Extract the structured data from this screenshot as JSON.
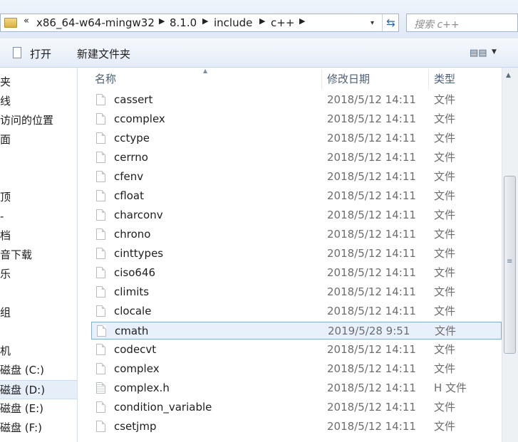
{
  "address": {
    "overflow": "«",
    "crumbs": [
      "x86_64-w64-mingw32",
      "8.1.0",
      "include",
      "c++"
    ],
    "dropdown_arrow": "▾",
    "refresh_icon": "refresh-icon",
    "search_placeholder": "搜索 c++"
  },
  "toolbar": {
    "open_label": "打开",
    "new_folder_label": "新建文件夹"
  },
  "columns": {
    "name": "名称",
    "date": "修改日期",
    "type": "类型"
  },
  "nav": {
    "items": [
      "夹",
      "线",
      "访问的位置",
      "面",
      "",
      "",
      "顶",
      "-",
      "档",
      "音下载",
      "乐",
      "",
      "组",
      "",
      "机",
      "磁盘 (C:)",
      "磁盘 (D:)",
      "磁盘 (E:)",
      "磁盘 (F:)"
    ],
    "selected_index": 16
  },
  "files": [
    {
      "name": "cassert",
      "date": "2018/5/12 14:11",
      "type": "文件"
    },
    {
      "name": "ccomplex",
      "date": "2018/5/12 14:11",
      "type": "文件"
    },
    {
      "name": "cctype",
      "date": "2018/5/12 14:11",
      "type": "文件"
    },
    {
      "name": "cerrno",
      "date": "2018/5/12 14:11",
      "type": "文件"
    },
    {
      "name": "cfenv",
      "date": "2018/5/12 14:11",
      "type": "文件"
    },
    {
      "name": "cfloat",
      "date": "2018/5/12 14:11",
      "type": "文件"
    },
    {
      "name": "charconv",
      "date": "2018/5/12 14:11",
      "type": "文件"
    },
    {
      "name": "chrono",
      "date": "2018/5/12 14:11",
      "type": "文件"
    },
    {
      "name": "cinttypes",
      "date": "2018/5/12 14:11",
      "type": "文件"
    },
    {
      "name": "ciso646",
      "date": "2018/5/12 14:11",
      "type": "文件"
    },
    {
      "name": "climits",
      "date": "2018/5/12 14:11",
      "type": "文件"
    },
    {
      "name": "clocale",
      "date": "2018/5/12 14:11",
      "type": "文件"
    },
    {
      "name": "cmath",
      "date": "2019/5/28 9:51",
      "type": "文件"
    },
    {
      "name": "codecvt",
      "date": "2018/5/12 14:11",
      "type": "文件"
    },
    {
      "name": "complex",
      "date": "2018/5/12 14:11",
      "type": "文件"
    },
    {
      "name": "complex.h",
      "date": "2018/5/12 14:11",
      "type": "H 文件"
    },
    {
      "name": "condition_variable",
      "date": "2018/5/12 14:11",
      "type": "文件"
    },
    {
      "name": "csetjmp",
      "date": "2018/5/12 14:11",
      "type": "文件"
    }
  ],
  "selected_file_index": 12
}
